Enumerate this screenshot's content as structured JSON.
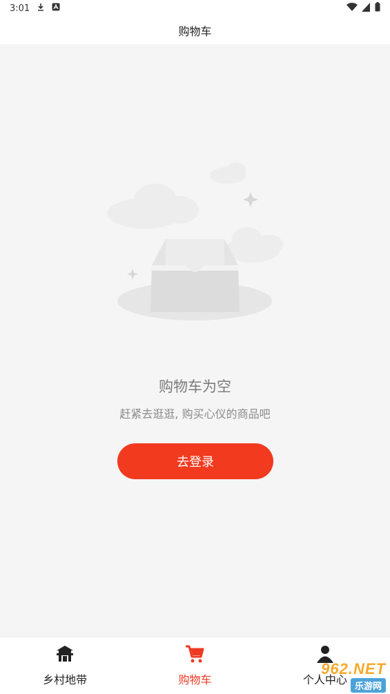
{
  "status_bar": {
    "time": "3:01",
    "icons": [
      "download-icon",
      "a-icon",
      "wifi-icon",
      "cellular-icon",
      "battery-icon"
    ]
  },
  "header": {
    "title": "购物车"
  },
  "empty_state": {
    "title": "购物车为空",
    "subtitle": "赶紧去逛逛, 购买心仪的商品吧",
    "button_label": "去登录"
  },
  "tabbar": {
    "items": [
      {
        "label": "乡村地带",
        "icon": "temple-icon",
        "active": false
      },
      {
        "label": "购物车",
        "icon": "cart-icon",
        "active": true
      },
      {
        "label": "个人中心",
        "icon": "person-icon",
        "active": false
      }
    ]
  },
  "watermark": {
    "line1": "962.NET",
    "line2": "乐游网"
  },
  "colors": {
    "accent": "#f23a1f",
    "background": "#f5f5f5"
  }
}
